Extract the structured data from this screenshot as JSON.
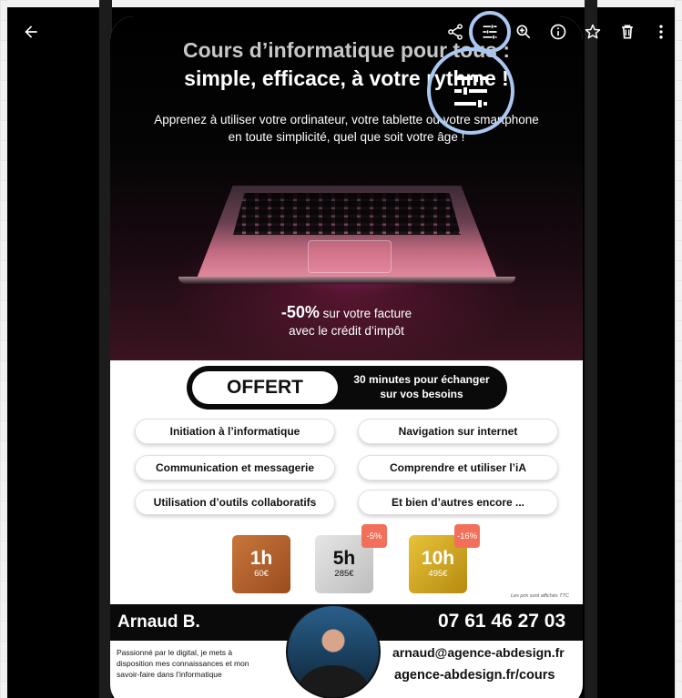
{
  "toolbar": {
    "icons": [
      "back-arrow-icon",
      "share-icon",
      "adjust-icon",
      "zoom-in-icon",
      "info-icon",
      "star-icon",
      "trash-icon",
      "more-icon"
    ]
  },
  "flyer": {
    "headline_line1": "Cours d’informatique pour tous :",
    "headline_line2": "simple, efficace, à votre rythme !",
    "subline_line1": "Apprenez à utiliser votre ordinateur, votre tablette ou votre smartphone",
    "subline_line2": "en toute simplicité, quel que soit votre âge !",
    "discount_pct": "-50%",
    "discount_line1_rest": " sur votre facture",
    "discount_line2": "avec le crédit d’impôt",
    "offer_label": "OFFERT",
    "offer_line1": "30 minutes pour échanger",
    "offer_line2": "sur vos besoins",
    "topics": [
      "Initiation à l’informatique",
      "Navigation sur internet",
      "Communication et messagerie",
      "Comprendre et utiliser l’iA",
      "Utilisation d’outils collaboratifs",
      "Et bien d’autres encore ..."
    ],
    "prices": [
      {
        "hours": "1h",
        "price": "60€"
      },
      {
        "hours": "5h",
        "price": "285€",
        "badge": "-5%"
      },
      {
        "hours": "10h",
        "price": "495€",
        "badge": "-16%"
      }
    ],
    "fineprint": "Les prix sont affichés TTC",
    "name": "Arnaud B.",
    "phone": "07 61 46 27 03",
    "bio_line1": "Passionné par le digital, je  mets à",
    "bio_line2": "disposition mes  connaissances et mon",
    "bio_line3": "savoir-faire dans l’informatique",
    "email": "arnaud@agence-abdesign.fr",
    "website": "agence-abdesign.fr/cours"
  }
}
